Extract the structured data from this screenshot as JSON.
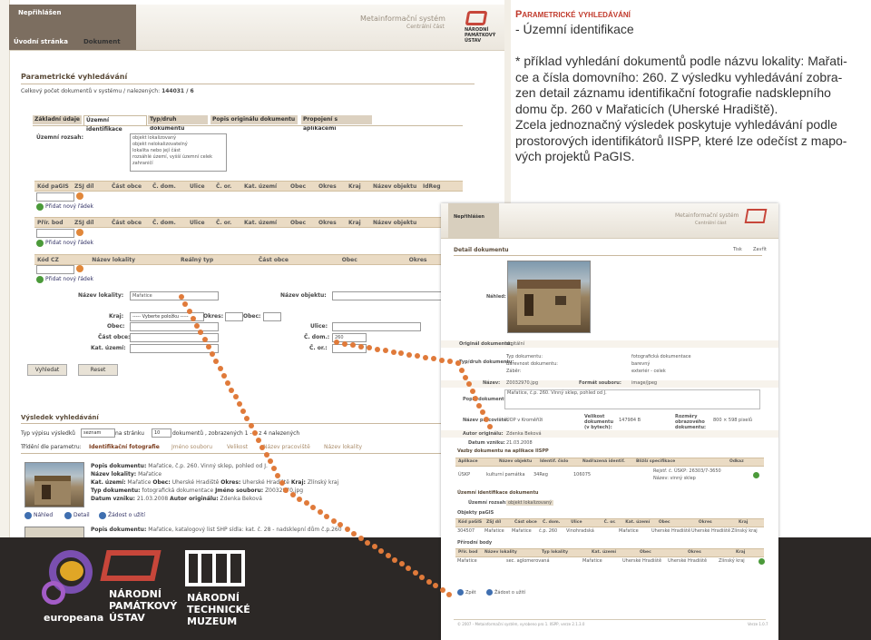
{
  "app": {
    "brand": "Nepřihlášen",
    "title_line1": "Metainformační systém",
    "title_line2": "Centrální část",
    "logo": [
      "NÁRODNÍ",
      "PAMÁTKOVÝ",
      "ÚSTAV"
    ],
    "nav": [
      "Úvodní stránka",
      "Dokument"
    ]
  },
  "search": {
    "heading": "Parametrické vyhledávání",
    "count_label": "Celkový počet dokumentů v systému / nalezených:",
    "count_value": "144031 / 6",
    "tabs": [
      "Základní údaje",
      "Územní identifikace",
      "Typ/druh dokumentu",
      "Popis originálu dokumentu",
      "Propojení s aplikacemi"
    ],
    "rozsah_label": "Územní rozsah:",
    "rozsah_options": [
      "objekt lokalizovaný",
      "objekt nelokalizovatelný",
      "lokalita nebo její část",
      "rozsáhlé území, vyšší územní celek",
      "zahraničí"
    ],
    "grid1": [
      "Kód paGIS",
      "ZSJ díl",
      "Část obce",
      "Č. dom.",
      "Ulice",
      "Č. or.",
      "Kat. území",
      "Obec",
      "Okres",
      "Kraj",
      "Název objektu",
      "IdReg"
    ],
    "grid2": [
      "Přír. bod",
      "ZSJ díl",
      "Část obce",
      "Č. dom.",
      "Ulice",
      "Č. or.",
      "Kat. území",
      "Obec",
      "Okres",
      "Kraj",
      "Název objektu"
    ],
    "grid3": [
      "Kód CZ",
      "Název lokality",
      "Reálný typ",
      "Část obce",
      "Obec",
      "Okres"
    ],
    "add_row": "Přidat nový řádek",
    "nazev_lokality_label": "Název lokality:",
    "nazev_lokality_value": "Mařatice",
    "nazev_objektu_label": "Název objektu:",
    "kraj_label": "Kraj:",
    "kraj_value": "----- Vyberte položku -----",
    "okres_label": "Okres:",
    "obec2_label": "Obec:",
    "obec_label": "Obec:",
    "ulice_label": "Ulice:",
    "cast_obce_label": "Část obce:",
    "c_dom_label": "Č. dom.:",
    "c_dom_value": "260",
    "kat_uzemi_label": "Kat. území:",
    "c_or_label": "Č. or.:",
    "btn_search": "Vyhledat",
    "btn_reset": "Reset"
  },
  "results": {
    "heading": "Výsledek vyhledávání",
    "listing_type_label": "Typ výpisu výsledků",
    "listing_type_value": "seznam",
    "per_page_prefix": "na stránku",
    "per_page_value": "10",
    "per_page_suffix": "dokumentů , zobrazených 1 - 4 z 4 nalezených",
    "sort_label": "Třídění dle parametru:",
    "sort_options": [
      "Identifikační fotografie",
      "Jméno souboru",
      "Velikost",
      "Název pracoviště",
      "Název lokality"
    ],
    "item": {
      "popis_label": "Popis dokumentu:",
      "popis": "Mařatice, č.p. 260. Vinný sklep, pohled od J.",
      "nazev_lokality_label": "Název lokality:",
      "nazev_lokality": "Mařatice",
      "kat_uzemi_label": "Kat. území:",
      "kat_uzemi": "Mařatice",
      "obec_label": "Obec:",
      "obec": "Uherské Hradiště",
      "okres_label": "Okres:",
      "okres": "Uherské Hradiště",
      "kraj_label": "Kraj:",
      "kraj": "Zlínský kraj",
      "typ_label": "Typ dokumentu:",
      "typ": "fotografická dokumentace",
      "jmeno_label": "Jméno souboru:",
      "jmeno": "Z0032970.jpg",
      "datum_label": "Datum vzniku:",
      "datum": "21.03.2008",
      "autor_label": "Autor originálu:",
      "autor": "Zdenka Beková"
    },
    "actions": [
      "Náhled",
      "Detail",
      "Žádost o užití"
    ],
    "item2_label": "Popis dokumentu:",
    "item2": "Mařatice, katalogový list SHP sídla: kat. č. 28 - nadsklepní dům č.p.260"
  },
  "caption": {
    "title": "Parametrické vyhledávání",
    "subtitle": "- Územní identifikace",
    "lines": [
      "* příklad vyhledání dokumentů podle názvu lokality: Mařati-",
      "ce a čísla domovního: 260. Z výsledku vyhledávání zobra-",
      "zen detail záznamu identifikační fotografie nadsklepního",
      "domu čp. 260 v Mařaticích (Uherské Hradiště).",
      "Zcela jednoznačný výsledek poskytuje vyhledávání podle",
      "prostorových identifikátorů IISPP, které lze odečíst z mapo-",
      "vých projektů PaGIS."
    ]
  },
  "detail": {
    "brand": "Nepřihlášen",
    "title_line1": "Metainformační systém",
    "title_line2": "Centrální část",
    "heading": "Detail dokumentu",
    "print": "Tisk",
    "close": "Zavřít",
    "nahled_label": "Náhled:",
    "orig_label": "Originál dokumentu:",
    "orig_value": "digitální",
    "typ_label": "Typ/druh dokumentu:",
    "typ_rows": [
      [
        "Typ dokumentu:",
        "fotografická dokumentace"
      ],
      [
        "Barevnost dokumentu:",
        "barevný"
      ],
      [
        "Záběr:",
        "exteriér - celek"
      ]
    ],
    "nazev_label": "Název:",
    "nazev_value": "Z0032970.jpg",
    "format_label": "Formát souboru:",
    "format_value": "image/jpeg",
    "popis_label": "Popis dokumentu:",
    "popis_value": "Mařatice, č.p. 260. Vinný sklep, pohled od J.",
    "prac_label": "Název pracoviště:",
    "prac_value": "ÚOP v Kroměříži",
    "velikost_label": "Velikost dokumentu (v bytech):",
    "velikost_value": "147984 B",
    "rozmer_label": "Rozměry obrazového dokumentu:",
    "rozmer_value": "800 × 598 pixelů",
    "autor_label": "Autor originálu:",
    "autor_value": "Zdenka Beková",
    "datum_label": "Datum vzniku:",
    "datum_value": "21.03.2008",
    "vazby_heading": "Vazby dokumentu na aplikace IISPP",
    "vazby_cols": [
      "Aplikace",
      "Název objektu",
      "Identif. číslo",
      "Nadřazená identif.",
      "Bližší specifikace",
      "Odkaz"
    ],
    "vazby_row": [
      "ÚSKP",
      "kulturní památka",
      "34Reg",
      "106075",
      "Rejstř. č. ÚSKP: 26303/7-3650",
      "Název: vinný sklep"
    ],
    "uzemni_heading": "Územní identifikace dokumentu",
    "rozsah_label": "Územní rozsah:",
    "rozsah_value": "objekt lokalizovaný",
    "pagis_label": "Objekty paGIS",
    "pagis_cols": [
      "Kód paGIS",
      "ZSJ díl",
      "Část obce",
      "Č. dom.",
      "Ulice",
      "Č. or.",
      "Kat. území",
      "Obec",
      "Okres",
      "Kraj"
    ],
    "pagis_row": [
      "304507",
      "Mařatice",
      "Mařatice",
      "č.p. 260",
      "Vinohradská",
      "",
      "Mařatice",
      "Uherské Hradiště",
      "Uherské Hradiště",
      "Zlínský kraj"
    ],
    "bod_label": "Přírodní body",
    "bod_cols": [
      "Přír. bod",
      "Název lokality",
      "Typ lokality",
      "Kat. území",
      "Obec",
      "Okres",
      "Kraj"
    ],
    "bod_row": [
      "Mařatice",
      "sec. aglomerovaná",
      "Mařatice",
      "Uherské Hradiště",
      "Uherské Hradiště",
      "Zlínský kraj"
    ],
    "back": "Zpět",
    "request": "Žádost o užití",
    "footer": "© 2007 - Metainformační systém, vyrobeno pro 1. IISPP, verze 2.1.3.0",
    "footer_right": "Verze 1.0.7"
  },
  "footer_logos": {
    "europeana": "europeana",
    "npu": [
      "NÁRODNÍ",
      "PAMÁTKOVÝ",
      "ÚSTAV"
    ],
    "ntm": [
      "NÁRODNÍ",
      "TECHNICKÉ",
      "MUZEUM"
    ]
  }
}
